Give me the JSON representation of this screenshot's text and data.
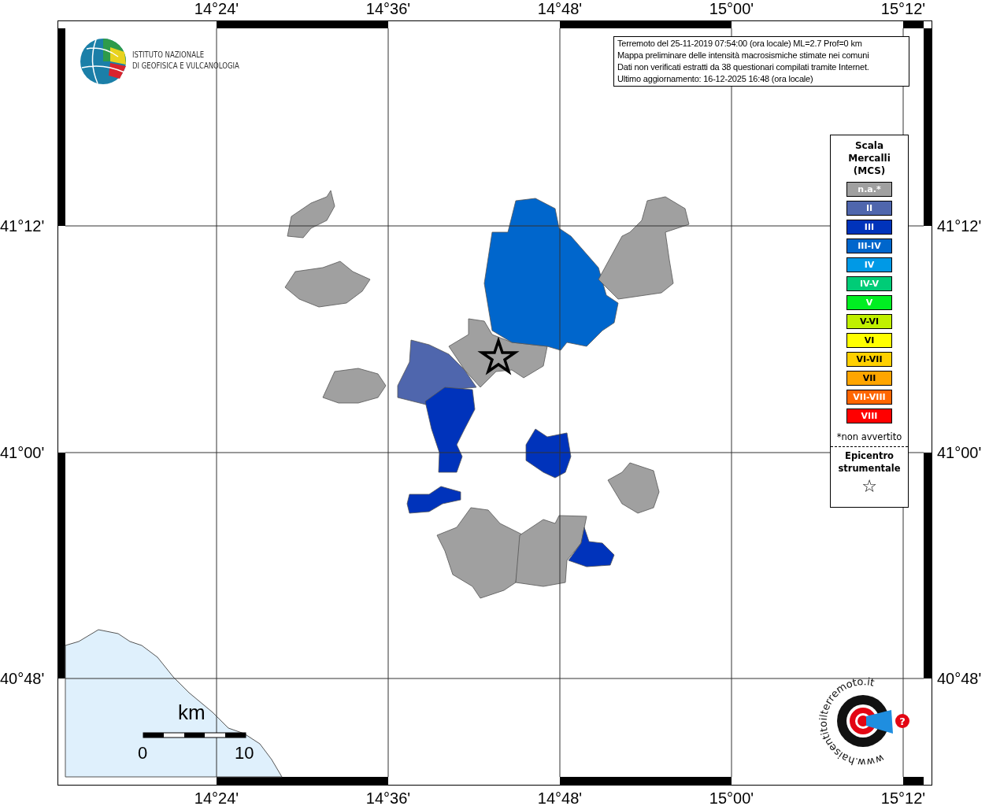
{
  "info_box": [
    "Terremoto del 25-11-2019 07:54:00 (ora locale) ML=2.7 Prof=0 km",
    "Mappa preliminare delle intensità macrosismiche stimate nei comuni",
    "Dati non verificati estratti da 38 questionari compilati tramite Internet.",
    "Ultimo aggiornamento: 16-12-2025 16:48 (ora locale)"
  ],
  "institute_logo": {
    "lines": [
      "ISTITUTO NAZIONALE",
      "DI GEOFISICA E VULCANOLOGIA"
    ]
  },
  "longitude_labels_top": [
    "14°24'",
    "14°36'",
    "14°48'",
    "15°00'",
    "15°12'"
  ],
  "latitude_labels_left": [
    "41°12'",
    "41°00'",
    "40°48'"
  ],
  "latitude_labels_right": [
    "41°12'",
    "41°00'",
    "40°48'"
  ],
  "longitude_labels_bottom": [
    "14°24'",
    "14°36'",
    "14°48'",
    "15°00'",
    "15°12'"
  ],
  "legend": {
    "title": "Scala Mercalli (MCS)",
    "items": [
      {
        "label": "n.a.*",
        "color": "#a0a0a0"
      },
      {
        "label": "II",
        "color": "#4f66ad"
      },
      {
        "label": "III",
        "color": "#0033bb"
      },
      {
        "label": "III-IV",
        "color": "#0066cc"
      },
      {
        "label": "IV",
        "color": "#0099e6"
      },
      {
        "label": "IV-V",
        "color": "#00cc77"
      },
      {
        "label": "V",
        "color": "#00ee22"
      },
      {
        "label": "V-VI",
        "color": "#c0f000"
      },
      {
        "label": "VI",
        "color": "#ffff00"
      },
      {
        "label": "VI-VII",
        "color": "#ffd000"
      },
      {
        "label": "VII",
        "color": "#ffa500"
      },
      {
        "label": "VII-VIII",
        "color": "#ff6600"
      },
      {
        "label": "VIII",
        "color": "#ff0000"
      }
    ],
    "note": "*non avvertito",
    "epicenter_label": "Epicentro strumentale",
    "epicenter_symbol": "☆"
  },
  "areas": [
    {
      "color": "#a0a0a0"
    },
    {
      "color": "#a0a0a0"
    },
    {
      "color": "#a0a0a0"
    },
    {
      "color": "#4f66ad"
    },
    {
      "color": "#a0a0a0"
    },
    {
      "color": "#0066cc"
    },
    {
      "color": "#a0a0a0"
    },
    {
      "color": "#0033bb"
    },
    {
      "color": "#0033bb"
    },
    {
      "color": "#0033bb"
    },
    {
      "color": "#a0a0a0"
    },
    {
      "color": "#a0a0a0"
    },
    {
      "color": "#a0a0a0"
    },
    {
      "color": "#0033bb"
    }
  ],
  "scale_bar": {
    "unit": "km",
    "start": "0",
    "end": "10"
  },
  "site_logo": {
    "text": "www.haisentitoilterremoto.it",
    "mark": "?"
  }
}
